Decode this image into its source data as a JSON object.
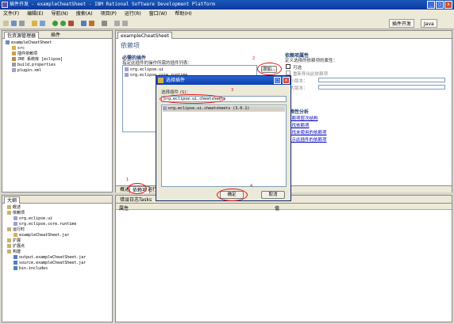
{
  "window": {
    "title": "插件开发 - exampleCheatSheet - IBM Rational Software Development Platform"
  },
  "menu": [
    "文件(F)",
    "编辑(E)",
    "导航(N)",
    "搜索(A)",
    "项目(P)",
    "运行(R)",
    "窗口(W)",
    "帮助(H)"
  ],
  "perspectives": {
    "active": "插件开发",
    "other": "Java"
  },
  "explorer": {
    "tabs": [
      "包资源管理器",
      "插件"
    ],
    "items": [
      "exampleCheatSheet",
      "src",
      "插件依赖项",
      "JRE 系统库 [eclipse]",
      "build.properties",
      "plugin.xml"
    ]
  },
  "outline": {
    "tab": "大纲",
    "items": [
      "概述",
      "依赖项",
      "org.eclipse.ui",
      "org.eclipse.core.runtime",
      "运行时",
      "exampleCheatSheet.jar",
      "扩展",
      "扩展点",
      "构建",
      "output.exampleCheatSheet.jar",
      "source.exampleCheatSheet.jar",
      "bin.includes"
    ]
  },
  "editor": {
    "tab": "exampleCheatSheet",
    "header": "依赖项",
    "required": {
      "title": "必需的插件",
      "desc": "指定此插件的操作所需的插件列表：",
      "items": [
        "org.eclipse.ui",
        "org.eclipse.core.runtime"
      ],
      "add_button": "添加..."
    },
    "properties": {
      "title": "依赖项属性",
      "desc": "定义选择的依赖项的属性：",
      "optional": "可选",
      "reexport": "重新导出此依赖项",
      "min_version": "最小版本：",
      "max_version": "最大版本："
    },
    "analysis": {
      "title": "依赖性分析",
      "links": [
        "依赖项层次结构",
        "查找依赖项",
        "查找未使用的依赖项",
        "显示此插件的依赖项"
      ]
    },
    "bottom_tabs": [
      "概述",
      "依赖项",
      "运行时",
      "扩展",
      "扩展点",
      "构建",
      "MANIFEST.MF",
      "plugin.xml",
      "build.properties"
    ]
  },
  "problems": {
    "tabs": [
      "错误日志",
      "Tasks",
      "问题",
      "属性"
    ],
    "columns": [
      "属性",
      "值"
    ]
  },
  "dialog": {
    "title": "选择插件",
    "label": "选择插件 (S)：",
    "filter_value": "org.eclipse.ui.cheatsheets",
    "result": "org.eclipse.ui.cheatsheets (3.0.1)",
    "ok": "确定",
    "cancel": "取消"
  },
  "callouts": [
    "1",
    "2",
    "3",
    "4"
  ],
  "colors": {
    "titlebar": "#0b3aa0",
    "callout": "#e01010",
    "link": "#0000c0"
  }
}
